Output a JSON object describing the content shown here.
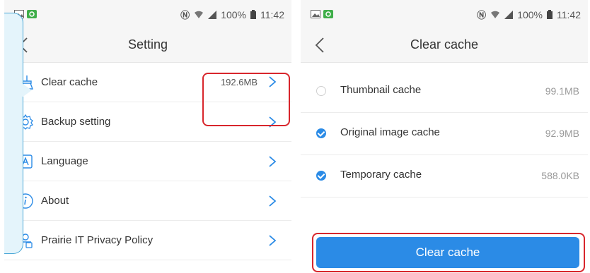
{
  "colors": {
    "accent": "#2b8be6",
    "highlight": "#d8262c",
    "callout_fill": "#e4f4fb"
  },
  "left_screen": {
    "status": {
      "battery": "100%",
      "time": "11:42"
    },
    "title": "Setting",
    "items": [
      {
        "label": "Clear cache",
        "value": "192.6MB",
        "icon": "broom-icon"
      },
      {
        "label": "Backup setting",
        "value": "",
        "icon": "gear-icon"
      },
      {
        "label": "Language",
        "value": "",
        "icon": "language-icon"
      },
      {
        "label": "About",
        "value": "",
        "icon": "info-icon"
      },
      {
        "label": "Prairie IT Privacy Policy",
        "value": "",
        "icon": "privacy-icon"
      }
    ]
  },
  "right_screen": {
    "status": {
      "battery": "100%",
      "time": "11:42"
    },
    "title": "Clear cache",
    "items": [
      {
        "label": "Thumbnail cache",
        "value": "99.1MB",
        "checked": false
      },
      {
        "label": "Original image cache",
        "value": "92.9MB",
        "checked": true
      },
      {
        "label": "Temporary cache",
        "value": "588.0KB",
        "checked": true
      }
    ],
    "button_label": "Clear cache"
  }
}
